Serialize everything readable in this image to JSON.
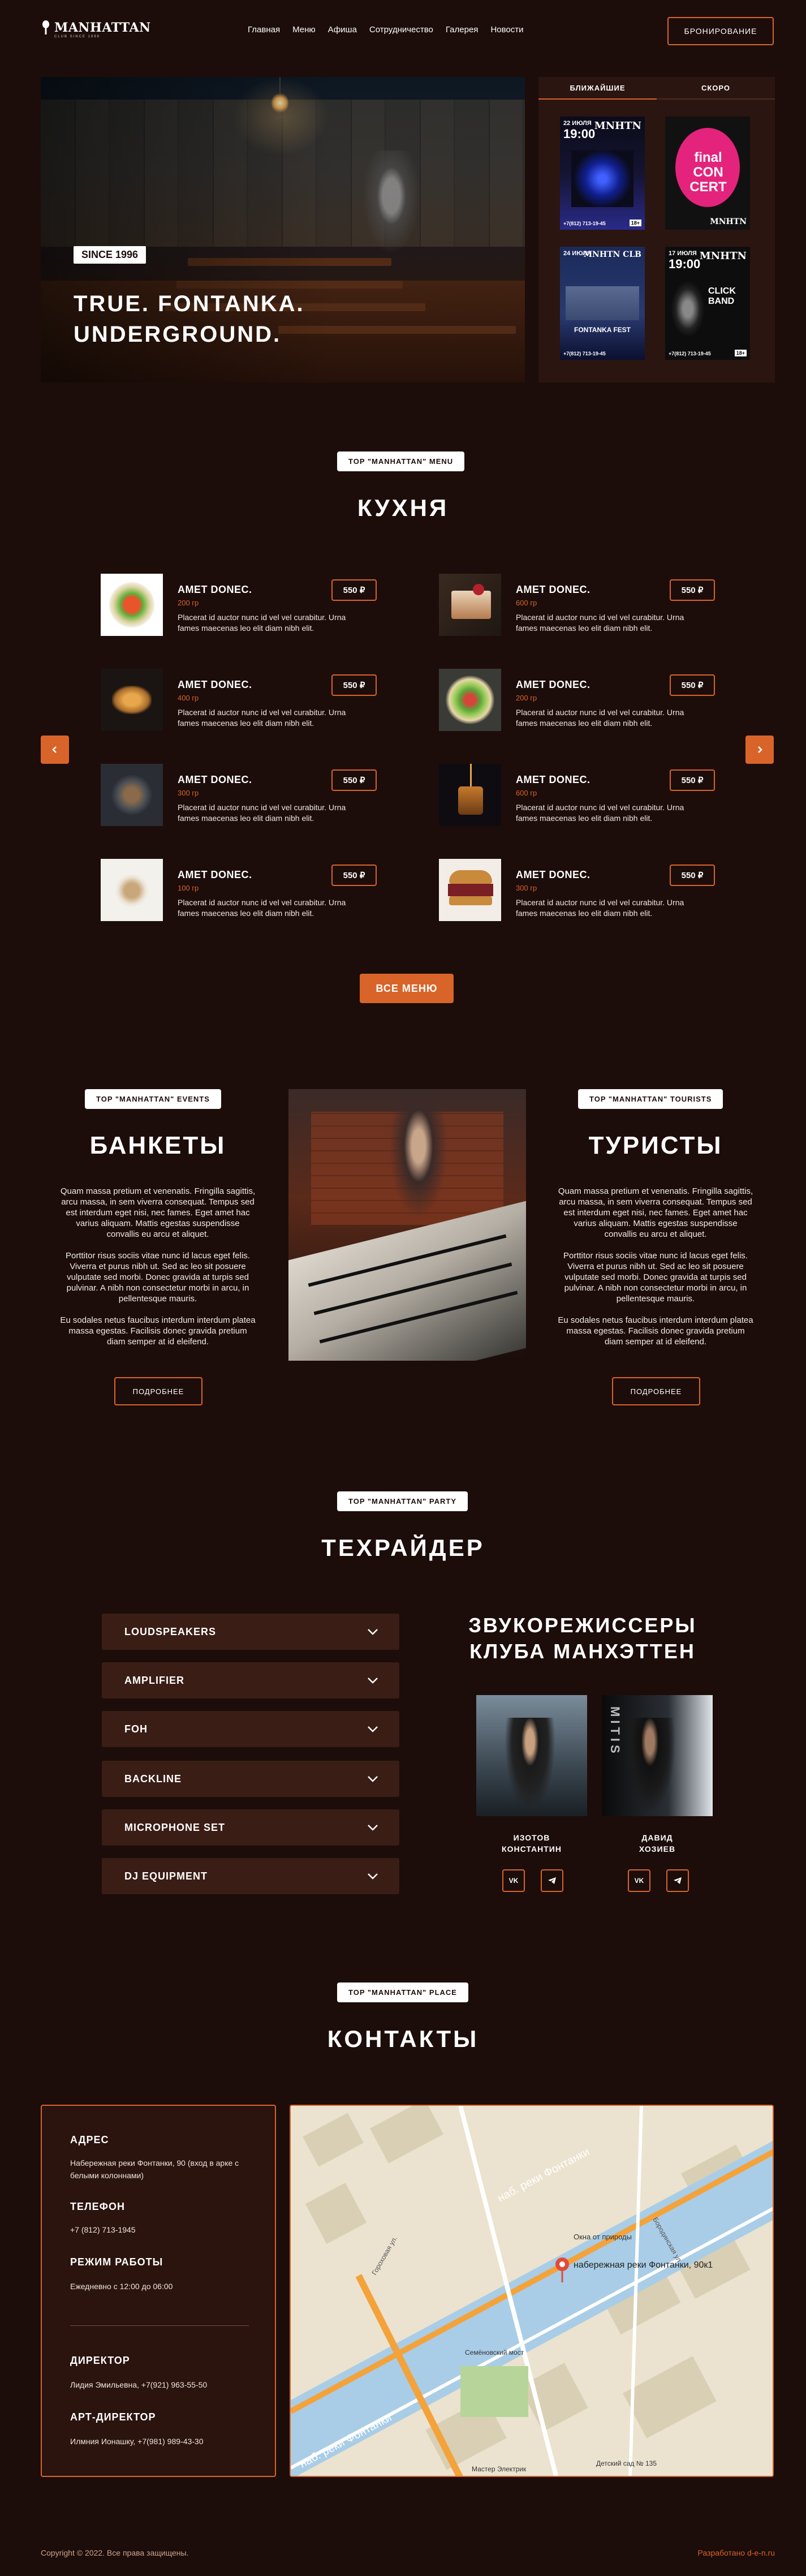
{
  "header": {
    "logo_text": "MANHATTAN",
    "logo_sub": "CLUB SINCE 1996",
    "nav": [
      "Главная",
      "Меню",
      "Афиша",
      "Сотрудничество",
      "Галерея",
      "Новости"
    ],
    "book_label": "Бронирование"
  },
  "hero": {
    "since": "SINCE 1996",
    "title_line1": "TRUE. FONTANKA.",
    "title_line2": "UNDERGROUND."
  },
  "events": {
    "tabs": [
      "БЛИЖАЙШИЕ",
      "СКОРО"
    ],
    "posters": [
      {
        "date": "22 ИЮЛЯ",
        "time": "19:00",
        "brand": "MNHTN",
        "phone": "+7(812) 713-19-45",
        "age": "18+"
      },
      {
        "title": "final CON CERT",
        "brand": "MNHTN"
      },
      {
        "date": "24 ИЮЛЯ",
        "brand": "MNHTN CLB",
        "title": "FONTANKA FEST",
        "phone": "+7(812) 713-19-45"
      },
      {
        "date": "17 ИЮЛЯ",
        "time": "19:00",
        "brand": "MNHTN",
        "title": "CLICK BAND",
        "phone": "+7(812) 713-19-45",
        "age": "18+"
      }
    ]
  },
  "menu": {
    "badge": "TOP \"MANHATTAN\" MENU",
    "title": "КУХНЯ",
    "dishes": [
      {
        "name": "AMET DONEC.",
        "weight": "200 гр",
        "desc": "Placerat id auctor nunc id vel vel curabitur. Urna fames maecenas leo elit diam nibh elit.",
        "price": "550 ₽"
      },
      {
        "name": "AMET DONEC.",
        "weight": "600 гр",
        "desc": "Placerat id auctor nunc id vel vel curabitur. Urna fames maecenas leo elit diam nibh elit.",
        "price": "550 ₽"
      },
      {
        "name": "AMET DONEC.",
        "weight": "400 гр",
        "desc": "Placerat id auctor nunc id vel vel curabitur. Urna fames maecenas leo elit diam nibh elit.",
        "price": "550 ₽"
      },
      {
        "name": "AMET DONEC.",
        "weight": "200 гр",
        "desc": "Placerat id auctor nunc id vel vel curabitur. Urna fames maecenas leo elit diam nibh elit.",
        "price": "550 ₽"
      },
      {
        "name": "AMET DONEC.",
        "weight": "300 гр",
        "desc": "Placerat id auctor nunc id vel vel curabitur. Urna fames maecenas leo elit diam nibh elit.",
        "price": "550 ₽"
      },
      {
        "name": "AMET DONEC.",
        "weight": "600 гр",
        "desc": "Placerat id auctor nunc id vel vel curabitur. Urna fames maecenas leo elit diam nibh elit.",
        "price": "550 ₽"
      },
      {
        "name": "AMET DONEC.",
        "weight": "100 гр",
        "desc": "Placerat id auctor nunc id vel vel curabitur. Urna fames maecenas leo elit diam nibh elit.",
        "price": "550 ₽"
      },
      {
        "name": "AMET DONEC.",
        "weight": "300 гр",
        "desc": "Placerat id auctor nunc id vel vel curabitur. Urna fames maecenas leo elit diam nibh elit.",
        "price": "550 ₽"
      }
    ],
    "all_label": "ВСЕ МЕНЮ"
  },
  "banquets": {
    "badge": "TOP \"MANHATTAN\" EVENTS",
    "title": "БАНКЕТЫ",
    "p1": "Quam massa pretium et venenatis. Fringilla sagittis, arcu massa, in sem viverra consequat. Tempus sed est interdum eget nisi, nec fames. Eget amet hac varius aliquam. Mattis egestas suspendisse convallis eu arcu et aliquet.",
    "p2": "Porttitor risus sociis vitae nunc id lacus eget felis. Viverra et purus nibh ut. Sed ac leo sit posuere vulputate sed morbi. Donec gravida at turpis sed pulvinar. A nibh non consectetur morbi in arcu, in pellentesque mauris.",
    "p3": "Eu sodales netus faucibus interdum interdum platea massa egestas. Facilisis donec gravida pretium diam semper at id eleifend.",
    "more": "Подробнее"
  },
  "tourists": {
    "badge": "TOP \"MANHATTAN\" TOURISTS",
    "title": "ТУРИСТЫ",
    "p1": "Quam massa pretium et venenatis. Fringilla sagittis, arcu massa, in sem viverra consequat. Tempus sed est interdum eget nisi, nec fames. Eget amet hac varius aliquam. Mattis egestas suspendisse convallis eu arcu et aliquet.",
    "p2": "Porttitor risus sociis vitae nunc id lacus eget felis. Viverra et purus nibh ut. Sed ac leo sit posuere vulputate sed morbi. Donec gravida at turpis sed pulvinar. A nibh non consectetur morbi in arcu, in pellentesque mauris.",
    "p3": "Eu sodales netus faucibus interdum interdum platea massa egestas. Facilisis donec gravida pretium diam semper at id eleifend.",
    "more": "Подробнее"
  },
  "rider": {
    "badge": "TOP \"MANHATTAN\" PARTY",
    "title": "ТЕХРАЙДЕР",
    "items": [
      "LOUDSPEAKERS",
      "AMPLIFIER",
      "FOH",
      "BACKLINE",
      "MICROPHONE SET",
      "DJ EQUIPMENT"
    ],
    "sound_title": "ЗВУКОРЕЖИССЕРЫ КЛУБА МАНХЭТТЕН",
    "engineers": [
      {
        "name1": "ИЗОТОВ",
        "name2": "КОНСТАНТИН"
      },
      {
        "name1": "ДАВИД",
        "name2": "ХОЗИЕВ"
      }
    ],
    "social": [
      "VK",
      "TG"
    ]
  },
  "contacts": {
    "badge": "TOP \"MANHATTAN\" PLACE",
    "title": "КОНТАКТЫ",
    "address_label": "АДРЕС",
    "address": "Набережная реки Фонтанки, 90 (вход в арке с белыми колоннами)",
    "phone_label": "ТЕЛЕФОН",
    "phone": "+7 (812) 713-1945",
    "hours_label": "РЕЖИМ РАБОТЫ",
    "hours": "Ежедневно с 12:00 до 06:00",
    "director_label": "ДИРЕКТОР",
    "director": "Лидия Эмильевна, +7(921) 963-55-50",
    "art_label": "АРТ-ДИРЕКТОР",
    "art": "Илмния Ионашку, +7(981) 989-43-30",
    "map": {
      "street1": "наб. реки Фонтанки",
      "street2": "наб. реки Фонтанки",
      "pin_label": "набережная реки Фонтанки, 90к1",
      "poi1": "Окна от природы",
      "poi2": "Семёновский мост",
      "poi3": "Детский сад № 135",
      "poi4": "Мастер Электрик",
      "poi5": "Бородинская ул.",
      "poi6": "Гороховая ул."
    }
  },
  "footer": {
    "copyright": "Copyright © 2022. Все права защищены.",
    "credit": "Разработано d-e-n.ru"
  },
  "colors": {
    "bg": "#1c0d0a",
    "accent": "#d9642a",
    "panel": "#3a1d15"
  }
}
